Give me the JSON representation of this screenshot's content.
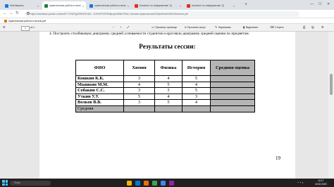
{
  "browser": {
    "tabs": [
      {
        "title": "Мой вашинь",
        "color": "#1a73e8",
        "active": false
      },
      {
        "title": "практическая работа в эксель",
        "color": "#188038",
        "active": true
      },
      {
        "title": "практическая работа в эксел",
        "color": "#1a73e8",
        "active": false
      },
      {
        "title": "Конспект по информатике \"Д",
        "color": "#d93025",
        "active": false
      },
      {
        "title": "Конспект по информатике \"Д",
        "color": "#d93025",
        "active": false
      }
    ],
    "address": "https://docviewer.yandex.ru/view/0/?*=f%2FgkYfM%2Fr4bJ…DJr%2F%2F5D8pzyAhZtMeT9nA==&name=практическая%20работа%20в%20эксель.pdf",
    "update_label": "Обновить Chrome"
  },
  "bookmarks": {
    "item": "практическая работа в эксель.pdf"
  },
  "pdf_toolbar": {
    "page": "1",
    "page_count": "из 1",
    "tools": [
      "Просмотр страницы",
      "Прочитать вслух",
      "Нарисовать",
      "Выделение",
      "Стереть"
    ],
    "icons": [
      "menu-icon",
      "zoom-out-icon",
      "zoom-in-icon",
      "fit-page-icon",
      "read-aloud-icon",
      "draw-icon",
      "highlight-icon",
      "erase-icon",
      "print-icon",
      "save-icon",
      "settings-icon"
    ]
  },
  "document": {
    "task_text": "4. Построить столбиковую диаграмму средней успеваемости студентов и круговую диаграмму средней оценки по предметам.",
    "title": "Результаты сессии:",
    "headers": [
      "ФИО",
      "Химия",
      "Физика",
      "История",
      "Средняя оценка"
    ],
    "rows": [
      {
        "name": "Кошкин К.К.",
        "values": [
          "3",
          "4",
          "5"
        ]
      },
      {
        "name": "Мышкин М.М.",
        "values": [
          "4",
          "5",
          "4"
        ]
      },
      {
        "name": "Собакин С.С.",
        "values": [
          "3",
          "3",
          "5"
        ]
      },
      {
        "name": "Уткин У.У.",
        "values": [
          "5",
          "4",
          "3"
        ]
      },
      {
        "name": "Волков В.В.",
        "values": [
          "3",
          "5",
          "4"
        ]
      }
    ],
    "footer_label": "Средняя",
    "page_number": "19"
  },
  "taskbar": {
    "search_placeholder": "Поиск",
    "time": "10:17",
    "date": "16.02.2023",
    "apps": [
      "#f4b400",
      "#0078d4",
      "#e8710a",
      "#34a853",
      "#4285f4",
      "#8e24aa"
    ]
  }
}
